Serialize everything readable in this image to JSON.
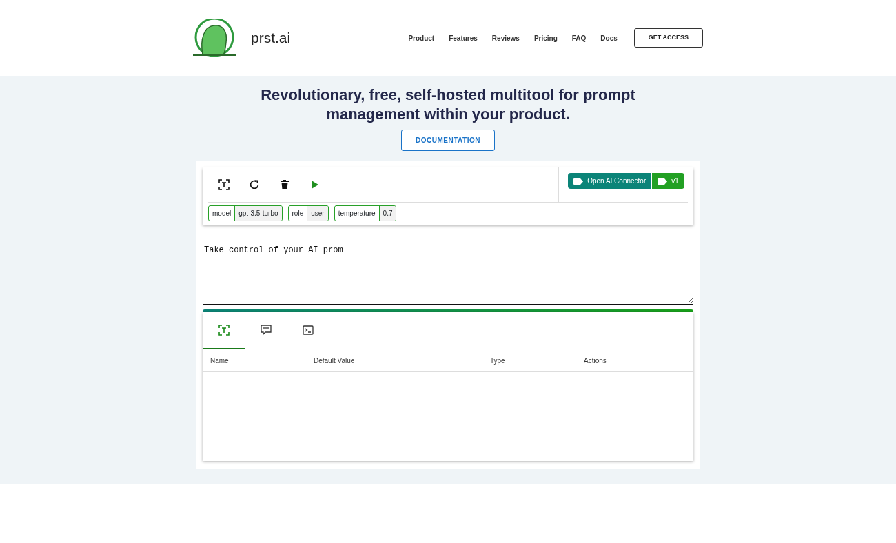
{
  "header": {
    "brand": "prst.ai",
    "nav": [
      "Product",
      "Features",
      "Reviews",
      "Pricing",
      "FAQ",
      "Docs"
    ],
    "cta": "GET ACCESS"
  },
  "hero": {
    "title": "Revolutionary, free, self-hosted multitool for prompt management within your product.",
    "button": "DOCUMENTATION"
  },
  "editor": {
    "toolbar": [
      {
        "kind": "variable"
      },
      {
        "kind": "refresh"
      },
      {
        "kind": "delete"
      },
      {
        "kind": "run"
      }
    ],
    "connector": {
      "name": "Open AI Connector",
      "version": "v1"
    },
    "params": [
      {
        "key": "model",
        "value": "gpt-3.5-turbo"
      },
      {
        "key": "role",
        "value": "user"
      },
      {
        "key": "temperature",
        "value": "0.7"
      }
    ],
    "prompt": "Take control of your AI prom",
    "tabs": [
      {
        "kind": "variable",
        "selected": true
      },
      {
        "kind": "quote",
        "selected": false
      },
      {
        "kind": "terminal",
        "selected": false
      }
    ],
    "table": {
      "columns": [
        "Name",
        "Default Value",
        "Type",
        "Actions"
      ]
    }
  }
}
